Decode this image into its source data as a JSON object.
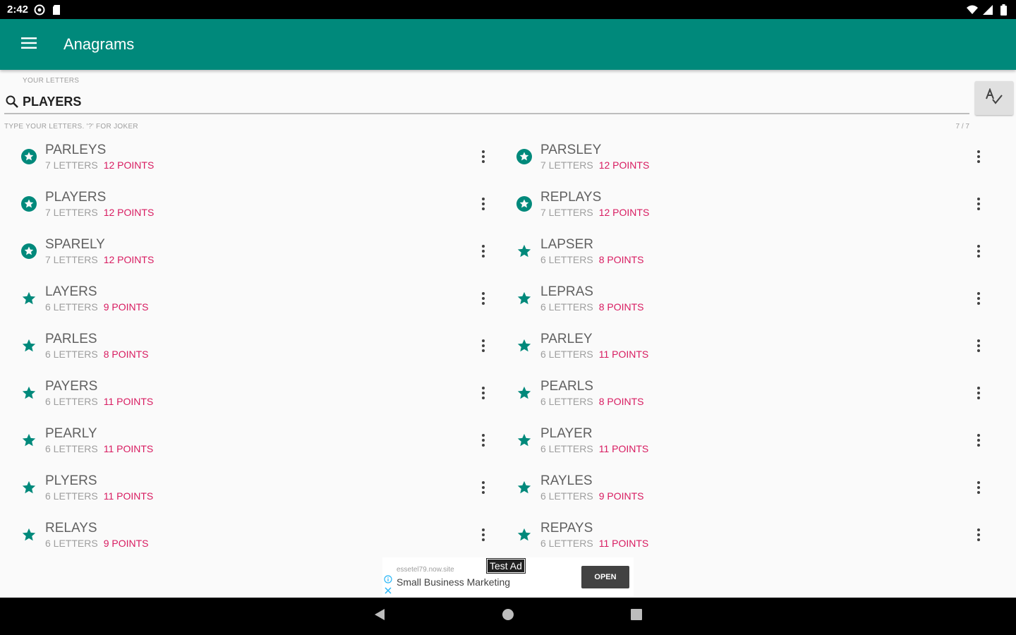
{
  "status_bar": {
    "time": "2:42",
    "icons": [
      "at-icon",
      "sd-card-icon"
    ],
    "right_icons": [
      "wifi-icon",
      "signal-icon",
      "battery-icon"
    ]
  },
  "app_bar": {
    "title": "Anagrams",
    "menu_icon": "hamburger-menu-icon"
  },
  "search": {
    "label": "YOUR LETTERS",
    "value": "PLAYERS",
    "hint": "TYPE YOUR LETTERS. '?' FOR JOKER",
    "counter": "7 / 7",
    "spell_icon": "spellcheck-icon"
  },
  "colors": {
    "primary": "#00897b",
    "accent": "#d81b60",
    "star": "#00897b"
  },
  "results": [
    {
      "word": "PARLEYS",
      "letters": "7 LETTERS",
      "points": "12 POINTS",
      "icon": "star-circle-icon"
    },
    {
      "word": "PARSLEY",
      "letters": "7 LETTERS",
      "points": "12 POINTS",
      "icon": "star-circle-icon"
    },
    {
      "word": "PLAYERS",
      "letters": "7 LETTERS",
      "points": "12 POINTS",
      "icon": "star-circle-icon"
    },
    {
      "word": "REPLAYS",
      "letters": "7 LETTERS",
      "points": "12 POINTS",
      "icon": "star-circle-icon"
    },
    {
      "word": "SPARELY",
      "letters": "7 LETTERS",
      "points": "12 POINTS",
      "icon": "star-circle-icon"
    },
    {
      "word": "LAPSER",
      "letters": "6 LETTERS",
      "points": "8 POINTS",
      "icon": "star-icon"
    },
    {
      "word": "LAYERS",
      "letters": "6 LETTERS",
      "points": "9 POINTS",
      "icon": "star-icon"
    },
    {
      "word": "LEPRAS",
      "letters": "6 LETTERS",
      "points": "8 POINTS",
      "icon": "star-icon"
    },
    {
      "word": "PARLES",
      "letters": "6 LETTERS",
      "points": "8 POINTS",
      "icon": "star-icon"
    },
    {
      "word": "PARLEY",
      "letters": "6 LETTERS",
      "points": "11 POINTS",
      "icon": "star-icon"
    },
    {
      "word": "PAYERS",
      "letters": "6 LETTERS",
      "points": "11 POINTS",
      "icon": "star-icon"
    },
    {
      "word": "PEARLS",
      "letters": "6 LETTERS",
      "points": "8 POINTS",
      "icon": "star-icon"
    },
    {
      "word": "PEARLY",
      "letters": "6 LETTERS",
      "points": "11 POINTS",
      "icon": "star-icon"
    },
    {
      "word": "PLAYER",
      "letters": "6 LETTERS",
      "points": "11 POINTS",
      "icon": "star-icon"
    },
    {
      "word": "PLYERS",
      "letters": "6 LETTERS",
      "points": "11 POINTS",
      "icon": "star-icon"
    },
    {
      "word": "RAYLES",
      "letters": "6 LETTERS",
      "points": "9 POINTS",
      "icon": "star-icon"
    },
    {
      "word": "RELAYS",
      "letters": "6 LETTERS",
      "points": "9 POINTS",
      "icon": "star-icon"
    },
    {
      "word": "REPAYS",
      "letters": "6 LETTERS",
      "points": "11 POINTS",
      "icon": "star-icon"
    }
  ],
  "ad": {
    "badge": "Test Ad",
    "domain": "essetel79.now.site",
    "title": "Small Business Marketing",
    "open_label": "OPEN"
  },
  "nav_bar": {
    "buttons": [
      "back-icon",
      "home-icon",
      "recents-icon"
    ]
  }
}
